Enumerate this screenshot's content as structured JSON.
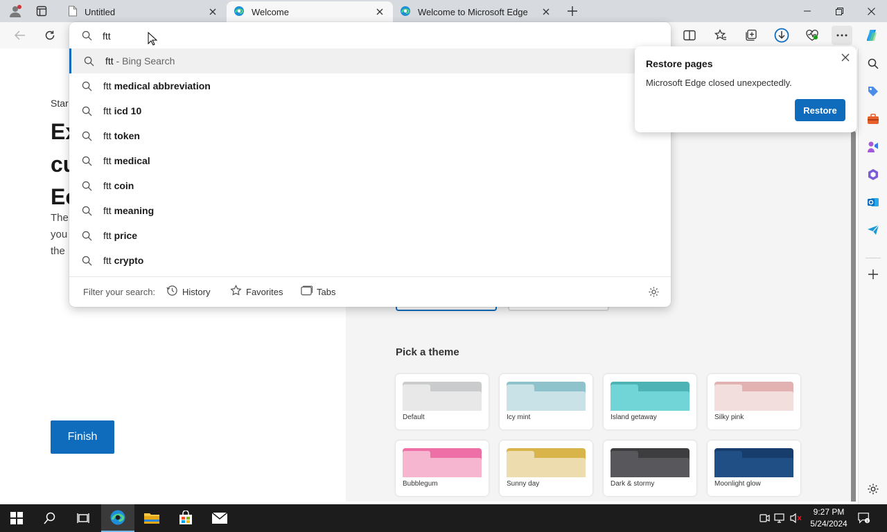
{
  "tabs": [
    {
      "title": "Untitled",
      "icon": "page-icon",
      "active": false
    },
    {
      "title": "Welcome",
      "icon": "edge-icon",
      "active": true
    },
    {
      "title": "Welcome to Microsoft Edge",
      "icon": "edge-icon",
      "active": false
    }
  ],
  "address": {
    "value": "ftt",
    "suggestions": [
      {
        "query": "ftt",
        "rest": "",
        "suffix": " - Bing Search",
        "highlighted": true
      },
      {
        "query": "ftt",
        "rest": "medical abbreviation"
      },
      {
        "query": "ftt",
        "rest": "icd 10"
      },
      {
        "query": "ftt",
        "rest": "token"
      },
      {
        "query": "ftt",
        "rest": "medical"
      },
      {
        "query": "ftt",
        "rest": "coin"
      },
      {
        "query": "ftt",
        "rest": "meaning"
      },
      {
        "query": "ftt",
        "rest": "price"
      },
      {
        "query": "ftt",
        "rest": "crypto"
      }
    ],
    "filter_label": "Filter your search:",
    "filters": [
      "History",
      "Favorites",
      "Tabs"
    ]
  },
  "restore_popup": {
    "title": "Restore pages",
    "message": "Microsoft Edge closed unexpectedly.",
    "button": "Restore"
  },
  "page": {
    "crumb": "Star",
    "heading_lines": [
      "Ex",
      "cu",
      "Ec"
    ],
    "body_lines": [
      "The",
      "you",
      "the"
    ],
    "finish": "Finish",
    "theme_title": "Pick a theme",
    "themes": [
      {
        "name": "Default",
        "back": "#c9cbcd",
        "front": "#e8e8e8"
      },
      {
        "name": "Icy mint",
        "back": "#8fc3cc",
        "front": "#c8e2e8"
      },
      {
        "name": "Island getaway",
        "back": "#4db3b5",
        "front": "#71d4d6"
      },
      {
        "name": "Silky pink",
        "back": "#e2b1b1",
        "front": "#f3dede"
      },
      {
        "name": "Bubblegum",
        "back": "#ee6fa5",
        "front": "#f6b6d0"
      },
      {
        "name": "Sunny day",
        "back": "#d9b44a",
        "front": "#ecdcae"
      },
      {
        "name": "Dark & stormy",
        "back": "#3d3d40",
        "front": "#58585c"
      },
      {
        "name": "Moonlight glow",
        "back": "#173d6c",
        "front": "#204f86"
      }
    ]
  },
  "taskbar": {
    "time": "9:27 PM",
    "date": "5/24/2024"
  },
  "colors": {
    "accent": "#0f6cbd",
    "tabstrip": "#d7dadf",
    "toolbar": "#f7f7f7",
    "taskbar": "#1c1c1c"
  }
}
